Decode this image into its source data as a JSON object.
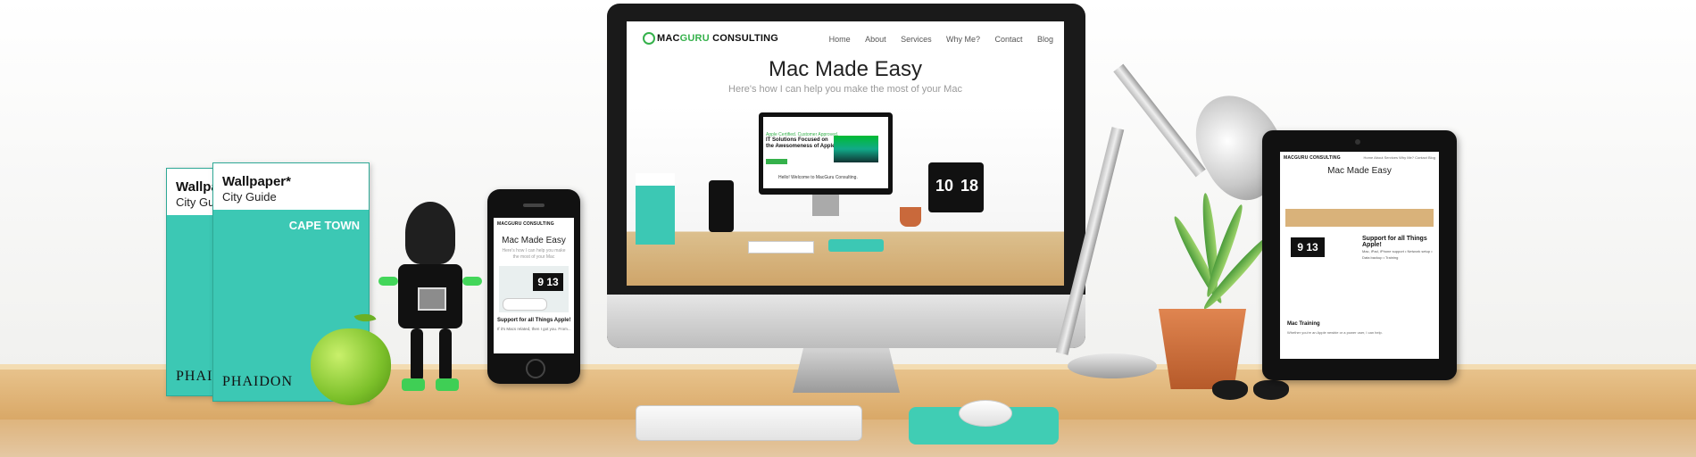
{
  "books": {
    "back": {
      "title": "Wallpaper*",
      "subtitle": "City Guide",
      "publisher": "PHAIDON"
    },
    "front": {
      "title": "Wallpaper*",
      "subtitle": "City Guide",
      "city": "CAPE TOWN",
      "publisher": "PHAIDON"
    }
  },
  "phone": {
    "logo": "MACGURU CONSULTING",
    "title": "Mac Made Easy",
    "subtitle": "Here's how I can help you make the most of your Mac",
    "clock": "9 13",
    "heading": "Support for all Things Apple!",
    "text": "If it's Macs related, then I got you. From..."
  },
  "imac": {
    "logo_pre": "MAC",
    "logo_mid": "GURU",
    "logo_post": " CONSULTING",
    "nav": [
      "Home",
      "About",
      "Services",
      "Why Me?",
      "Contact",
      "Blog"
    ],
    "title": "Mac Made Easy",
    "subtitle": "Here's how I can help you make the most of your Mac",
    "mini": {
      "tagline": "Apple Certified. Customer Approved.",
      "headline": "IT Solutions Focused on the Awesomeness of Apple.",
      "welcome": "Hello! Welcome to MacGuru Consulting.",
      "flip_left": "10",
      "flip_right": "18"
    }
  },
  "tablet": {
    "logo": "MACGURU CONSULTING",
    "nav": "Home  About  Services  Why Me?  Contact  Blog",
    "title": "Mac Made Easy",
    "clock": "9 13",
    "heading": "Support for all Things Apple!",
    "list": "Mac, iPad, iPhone support • Network setup • Data backup • Training",
    "heading2": "Mac Training",
    "text": "Whether you're an Apple newbie or a power user, I can help."
  }
}
